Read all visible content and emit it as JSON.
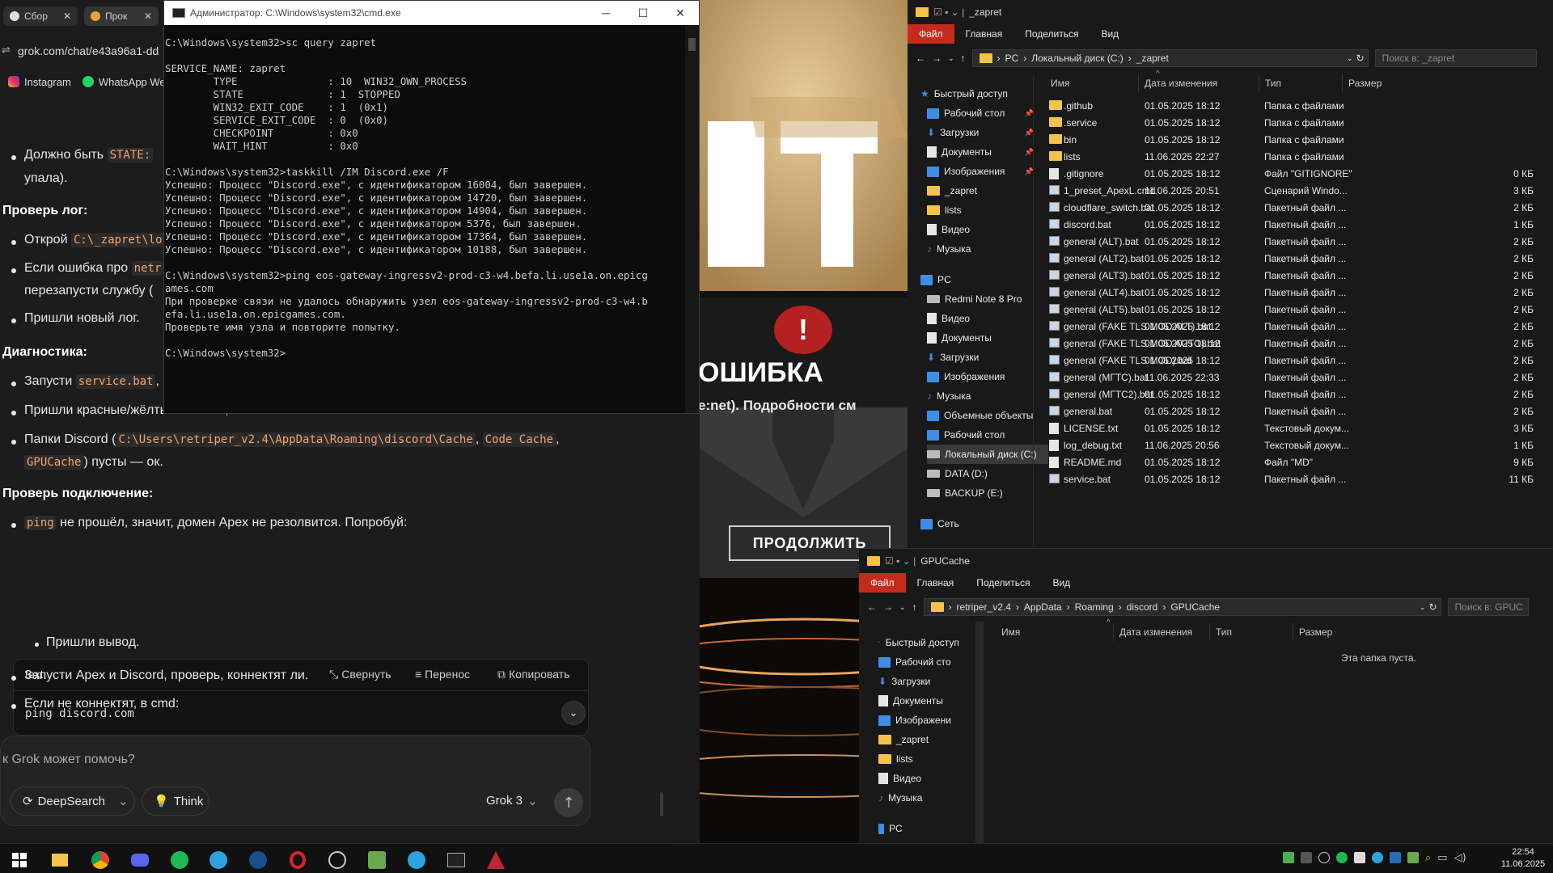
{
  "browser": {
    "tabs": [
      "Сбор",
      "Прок"
    ],
    "url": "grok.com/chat/e43a96a1-dd",
    "bookmarks": [
      "Instagram",
      "WhatsApp Wel"
    ]
  },
  "chat": {
    "b1a": "Должно быть ",
    "b1code": "STATE: ",
    "b1b": "упала).",
    "h_log": "Проверь лог:",
    "b2a": "Открой ",
    "b2code": "C:\\_zapret\\lo",
    "b3a": "Если ошибка про ",
    "b3code": "netr",
    "b3b": "перезапусти службу (",
    "b4": "Пришли новый лог.",
    "h_diag": "Диагностика:",
    "b5a": "Запусти ",
    "b5code": "service.bat",
    "b5b": ",",
    "b6": "Пришли красные/жёлтые ошибки, если есть.",
    "b7a": "Папки Discord (",
    "b7c1": "C:\\Users\\retriper_v2.4\\AppData\\Roaming\\discord\\Cache",
    "b7c2": "Code Cache",
    "b7c3": "GPUCache",
    "b7b": ") пусты — ок.",
    "h_conn": "Проверь подключение:",
    "b8code": "ping",
    "b8b": " не прошёл, значит, домен Apex не резолвится. Попробуй:",
    "code_lang": "text",
    "collapse": "Свернуть",
    "wrap": "Перенос",
    "copy": "Копировать",
    "code": "ping discord.com",
    "b9": "Пришли вывод.",
    "b10": "Запусти Apex и Discord, проверь, коннектят ли.",
    "b11": "Если не коннектят, в cmd:",
    "input_placeholder": "к Grok может помочь?",
    "deepsearch": "DeepSearch",
    "think": "Think",
    "model": "Grok 3"
  },
  "cmd": {
    "title": "Администратор: C:\\Windows\\system32\\cmd.exe",
    "lines": [
      "C:\\Windows\\system32>sc query zapret",
      "",
      "SERVICE_NAME: zapret",
      "        TYPE               : 10  WIN32_OWN_PROCESS",
      "        STATE              : 1  STOPPED",
      "        WIN32_EXIT_CODE    : 1  (0x1)",
      "        SERVICE_EXIT_CODE  : 0  (0x0)",
      "        CHECKPOINT         : 0x0",
      "        WAIT_HINT          : 0x0",
      "",
      "C:\\Windows\\system32>taskkill /IM Discord.exe /F",
      "Успешно: Процесс \"Discord.exe\", с идентификатором 16004, был завершен.",
      "Успешно: Процесс \"Discord.exe\", с идентификатором 14720, был завершен.",
      "Успешно: Процесс \"Discord.exe\", с идентификатором 14904, был завершен.",
      "Успешно: Процесс \"Discord.exe\", с идентификатором 5376, был завершен.",
      "Успешно: Процесс \"Discord.exe\", с идентификатором 17364, был завершен.",
      "Успешно: Процесс \"Discord.exe\", с идентификатором 10188, был завершен.",
      "",
      "C:\\Windows\\system32>ping eos-gateway-ingressv2-prod-c3-w4.befa.li.use1a.on.epicg",
      "ames.com",
      "При проверке связи не удалось обнаружить узел eos-gateway-ingressv2-prod-c3-w4.b",
      "efa.li.use1a.on.epicgames.com.",
      "Проверьте имя узла и повторите попытку.",
      "",
      "C:\\Windows\\system32>"
    ]
  },
  "game": {
    "error_title": "ОШИБКА",
    "error_detail": "e:net). Подробности см",
    "continue": "ПРОДОЛЖИТЬ"
  },
  "explorer1": {
    "title": "_zapret",
    "ribbon": [
      "Файл",
      "Главная",
      "Поделиться",
      "Вид"
    ],
    "path": [
      "PC",
      "Локальный диск (C:)",
      "_zapret"
    ],
    "search": "Поиск в: _zapret",
    "nav": [
      {
        "icon": "star",
        "label": "Быстрый доступ"
      },
      {
        "icon": "desktop",
        "label": "Рабочий стол",
        "pin": true
      },
      {
        "icon": "download",
        "label": "Загрузки",
        "pin": true
      },
      {
        "icon": "doc",
        "label": "Документы",
        "pin": true
      },
      {
        "icon": "image",
        "label": "Изображения",
        "pin": true
      },
      {
        "icon": "folder",
        "label": "_zapret"
      },
      {
        "icon": "folder",
        "label": "lists"
      },
      {
        "icon": "video",
        "label": "Видео"
      },
      {
        "icon": "music",
        "label": "Музыка"
      },
      {
        "icon": "pc",
        "label": "PC",
        "gap": true
      },
      {
        "icon": "phone",
        "label": "Redmi Note 8 Pro"
      },
      {
        "icon": "video",
        "label": "Видео"
      },
      {
        "icon": "doc",
        "label": "Документы"
      },
      {
        "icon": "download",
        "label": "Загрузки"
      },
      {
        "icon": "image",
        "label": "Изображения"
      },
      {
        "icon": "music",
        "label": "Музыка"
      },
      {
        "icon": "cube",
        "label": "Объемные объекты"
      },
      {
        "icon": "desktop",
        "label": "Рабочий стол"
      },
      {
        "icon": "drive",
        "label": "Локальный диск (C:)",
        "selected": true
      },
      {
        "icon": "drive",
        "label": "DATA (D:)"
      },
      {
        "icon": "drive",
        "label": "BACKUP (E:)"
      },
      {
        "icon": "net",
        "label": "Сеть",
        "gap": true
      }
    ],
    "columns": [
      "Имя",
      "Дата изменения",
      "Тип",
      "Размер"
    ],
    "files": [
      {
        "name": ".github",
        "date": "01.05.2025 18:12",
        "type": "Папка с файлами",
        "size": "",
        "kind": "folder"
      },
      {
        "name": ".service",
        "date": "01.05.2025 18:12",
        "type": "Папка с файлами",
        "size": "",
        "kind": "folder"
      },
      {
        "name": "bin",
        "date": "01.05.2025 18:12",
        "type": "Папка с файлами",
        "size": "",
        "kind": "folder"
      },
      {
        "name": "lists",
        "date": "11.06.2025 22:27",
        "type": "Папка с файлами",
        "size": "",
        "kind": "folder"
      },
      {
        "name": ".gitignore",
        "date": "01.05.2025 18:12",
        "type": "Файл \"GITIGNORE\"",
        "size": "0 КБ",
        "kind": "file"
      },
      {
        "name": "1_preset_ApexL.cmd",
        "date": "11.06.2025 20:51",
        "type": "Сценарий Windo...",
        "size": "3 КБ",
        "kind": "bat"
      },
      {
        "name": "cloudflare_switch.bat",
        "date": "01.05.2025 18:12",
        "type": "Пакетный файл ...",
        "size": "2 КБ",
        "kind": "bat"
      },
      {
        "name": "discord.bat",
        "date": "01.05.2025 18:12",
        "type": "Пакетный файл ...",
        "size": "1 КБ",
        "kind": "bat"
      },
      {
        "name": "general (ALT).bat",
        "date": "01.05.2025 18:12",
        "type": "Пакетный файл ...",
        "size": "2 КБ",
        "kind": "bat"
      },
      {
        "name": "general (ALT2).bat",
        "date": "01.05.2025 18:12",
        "type": "Пакетный файл ...",
        "size": "2 КБ",
        "kind": "bat"
      },
      {
        "name": "general (ALT3).bat",
        "date": "01.05.2025 18:12",
        "type": "Пакетный файл ...",
        "size": "2 КБ",
        "kind": "bat"
      },
      {
        "name": "general (ALT4).bat",
        "date": "01.05.2025 18:12",
        "type": "Пакетный файл ...",
        "size": "2 КБ",
        "kind": "bat"
      },
      {
        "name": "general (ALT5).bat",
        "date": "01.05.2025 18:12",
        "type": "Пакетный файл ...",
        "size": "2 КБ",
        "kind": "bat"
      },
      {
        "name": "general (FAKE TLS MOD ALT).bat",
        "date": "01.05.2025 18:12",
        "type": "Пакетный файл ...",
        "size": "2 КБ",
        "kind": "bat"
      },
      {
        "name": "general (FAKE TLS MOD AUTO).bat",
        "date": "01.05.2025 18:12",
        "type": "Пакетный файл ...",
        "size": "2 КБ",
        "kind": "bat"
      },
      {
        "name": "general (FAKE TLS MOD).bat",
        "date": "01.05.2025 18:12",
        "type": "Пакетный файл ...",
        "size": "2 КБ",
        "kind": "bat"
      },
      {
        "name": "general (МГТС).bat",
        "date": "11.06.2025 22:33",
        "type": "Пакетный файл ...",
        "size": "2 КБ",
        "kind": "bat"
      },
      {
        "name": "general (МГТС2).bat",
        "date": "01.05.2025 18:12",
        "type": "Пакетный файл ...",
        "size": "2 КБ",
        "kind": "bat"
      },
      {
        "name": "general.bat",
        "date": "01.05.2025 18:12",
        "type": "Пакетный файл ...",
        "size": "2 КБ",
        "kind": "bat"
      },
      {
        "name": "LICENSE.txt",
        "date": "01.05.2025 18:12",
        "type": "Текстовый докум...",
        "size": "3 КБ",
        "kind": "file"
      },
      {
        "name": "log_debug.txt",
        "date": "11.06.2025 20:56",
        "type": "Текстовый докум...",
        "size": "1 КБ",
        "kind": "file"
      },
      {
        "name": "README.md",
        "date": "01.05.2025 18:12",
        "type": "Файл \"MD\"",
        "size": "9 КБ",
        "kind": "file"
      },
      {
        "name": "service.bat",
        "date": "01.05.2025 18:12",
        "type": "Пакетный файл ...",
        "size": "11 КБ",
        "kind": "bat"
      }
    ]
  },
  "explorer2": {
    "title": "GPUCache",
    "ribbon": [
      "Файл",
      "Главная",
      "Поделиться",
      "Вид"
    ],
    "path": [
      "retriper_v2.4",
      "AppData",
      "Roaming",
      "discord",
      "GPUCache"
    ],
    "search": "Поиск в: GPUC",
    "nav": [
      {
        "icon": "star",
        "label": "Быстрый доступ"
      },
      {
        "icon": "desktop",
        "label": "Рабочий сто",
        "pin": true
      },
      {
        "icon": "download",
        "label": "Загрузки",
        "pin": true
      },
      {
        "icon": "doc",
        "label": "Документы",
        "pin": true
      },
      {
        "icon": "image",
        "label": "Изображени",
        "pin": true
      },
      {
        "icon": "folder",
        "label": "_zapret"
      },
      {
        "icon": "folder",
        "label": "lists"
      },
      {
        "icon": "video",
        "label": "Видео"
      },
      {
        "icon": "music",
        "label": "Музыка"
      },
      {
        "icon": "pc",
        "label": "PC",
        "gap": true
      }
    ],
    "columns": [
      "Имя",
      "Дата изменения",
      "Тип",
      "Размер"
    ],
    "empty": "Эта папка пуста."
  },
  "taskbar": {
    "time": "22:54",
    "date": "11.06.2025"
  },
  "colors": {
    "accent_red": "#c42b1c",
    "cmd_bg": "#0c0c0c",
    "code_orange": "#f2a36b"
  }
}
